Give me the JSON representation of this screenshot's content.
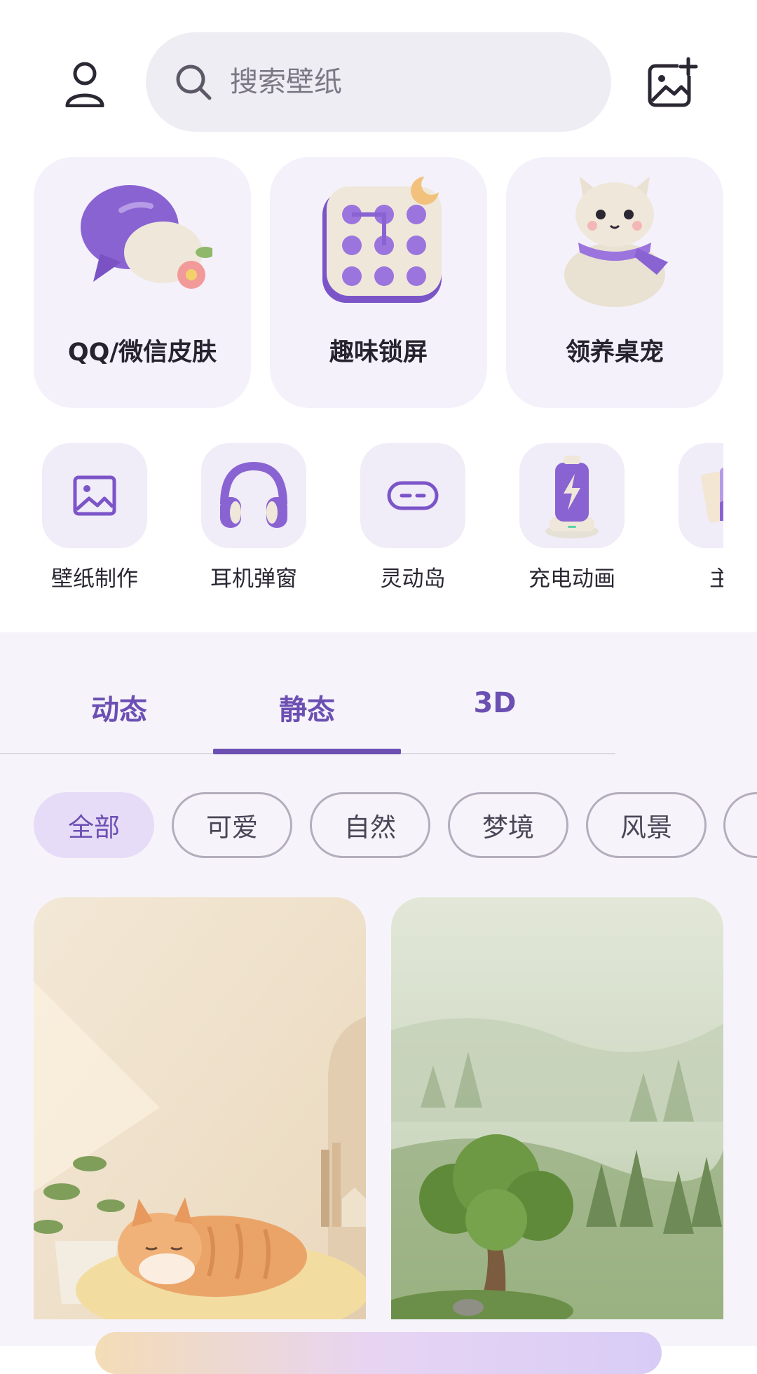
{
  "header": {
    "search_placeholder": "搜索壁纸",
    "avatar_icon": "user-icon",
    "add_wallpaper_icon": "image-plus-icon"
  },
  "feature_cards": [
    {
      "label": "QQ/微信皮肤",
      "icon": "chat-bubbles-icon"
    },
    {
      "label": "趣味锁屏",
      "icon": "pattern-lock-icon"
    },
    {
      "label": "领养桌宠",
      "icon": "cat-pet-icon"
    }
  ],
  "tools": [
    {
      "label": "壁纸制作",
      "icon": "image-icon"
    },
    {
      "label": "耳机弹窗",
      "icon": "headphones-icon"
    },
    {
      "label": "灵动岛",
      "icon": "dynamic-island-icon"
    },
    {
      "label": "充电动画",
      "icon": "battery-charging-icon"
    },
    {
      "label": "主题",
      "icon": "theme-cards-icon"
    }
  ],
  "tabs": [
    {
      "label": "动态"
    },
    {
      "label": "静态",
      "active": true
    },
    {
      "label": "3D"
    }
  ],
  "chips": [
    {
      "label": "全部",
      "active": true
    },
    {
      "label": "可爱"
    },
    {
      "label": "自然"
    },
    {
      "label": "梦境"
    },
    {
      "label": "风景"
    }
  ],
  "wallpapers": [
    {
      "subject": "sleeping-cat-wallpaper"
    },
    {
      "subject": "misty-forest-tree-wallpaper"
    }
  ],
  "colors": {
    "accent": "#6c4fb3",
    "card_bg": "#f4f1fb",
    "chip_active_bg": "#e6dcf7",
    "search_bg": "#efedf4"
  }
}
